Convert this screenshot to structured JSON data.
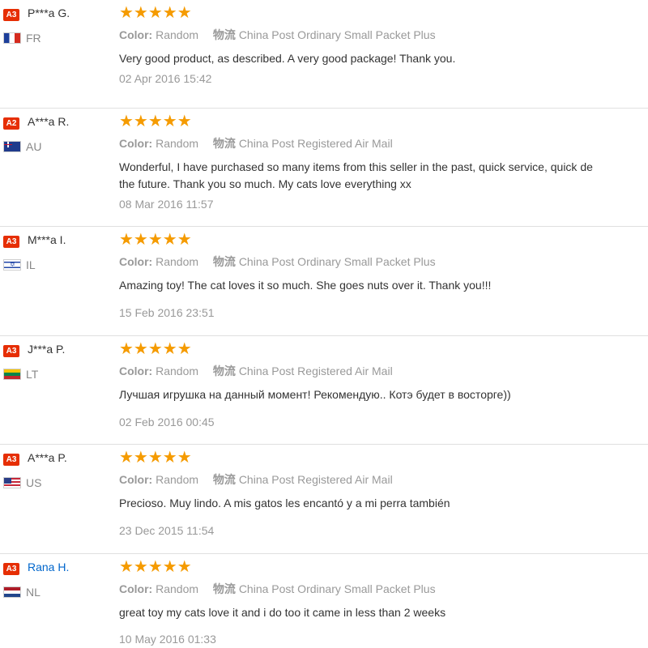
{
  "colors": {
    "badge_red": "#e62e04",
    "star_orange": "#f59b00",
    "link_blue": "#0066cc"
  },
  "labels": {
    "color_label": "Color:",
    "shipping_label": "物流"
  },
  "reviews": [
    {
      "badge": "A3",
      "name": "P***a G.",
      "country": "FR",
      "flag_icon": "flag-fr-icon",
      "rating": 5,
      "stars": "★★★★★",
      "color": "Random",
      "shipping": "China Post Ordinary Small Packet Plus",
      "text": "Very good product, as described. A very good package! Thank you.",
      "date": "02 Apr 2016 15:42"
    },
    {
      "badge": "A2",
      "name": "A***a R.",
      "country": "AU",
      "flag_icon": "flag-au-icon",
      "rating": 5,
      "stars": "★★★★★",
      "color": "Random",
      "shipping": "China Post Registered Air Mail",
      "text": "Wonderful, I have purchased so many items from this seller in the past, quick service, quick de\nthe future. Thank you so much. My cats love everything xx",
      "date": "08 Mar 2016 11:57"
    },
    {
      "badge": "A3",
      "name": "M***a I.",
      "country": "IL",
      "flag_icon": "flag-il-icon",
      "rating": 5,
      "stars": "★★★★★",
      "color": "Random",
      "shipping": "China Post Ordinary Small Packet Plus",
      "text": "Amazing toy! The cat loves it so much. She goes nuts over it. Thank you!!!",
      "date": "15 Feb 2016 23:51"
    },
    {
      "badge": "A3",
      "name": "J***a P.",
      "country": "LT",
      "flag_icon": "flag-lt-icon",
      "rating": 5,
      "stars": "★★★★★",
      "color": "Random",
      "shipping": "China Post Registered Air Mail",
      "text": "Лучшая игрушка на данный момент! Рекомендую.. Котэ будет в восторге))",
      "date": "02 Feb 2016 00:45"
    },
    {
      "badge": "A3",
      "name": "A***a P.",
      "country": "US",
      "flag_icon": "flag-us-icon",
      "rating": 5,
      "stars": "★★★★★",
      "color": "Random",
      "shipping": "China Post Registered Air Mail",
      "text": "Precioso. Muy lindo. A mis gatos les encantó y a mi perra también",
      "date": "23 Dec 2015 11:54"
    },
    {
      "badge": "A3",
      "name": "Rana H.",
      "country": "NL",
      "flag_icon": "flag-nl-icon",
      "rating": 5,
      "stars": "★★★★★",
      "color": "Random",
      "shipping": "China Post Ordinary Small Packet Plus",
      "text": "great toy my cats love it and i do too it came in less than 2 weeks",
      "date": "10 May 2016 01:33"
    }
  ]
}
